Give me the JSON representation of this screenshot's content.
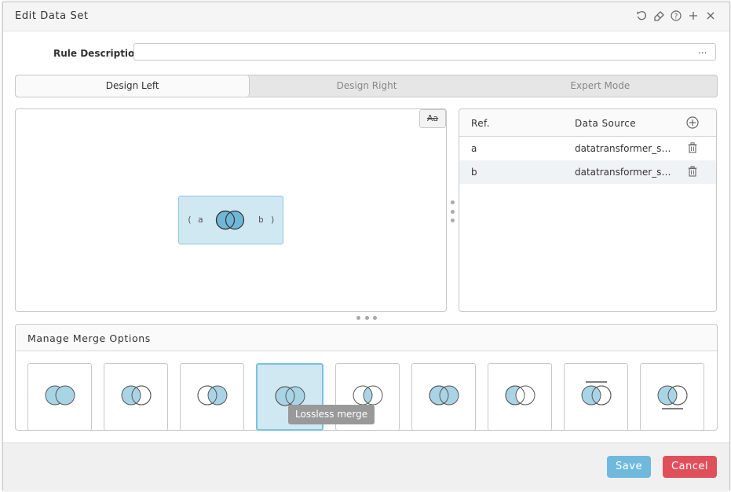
{
  "dialog": {
    "title": "Edit Data Set",
    "toolbar_icons": [
      "undo-icon",
      "eraser-icon",
      "help-icon",
      "plus-icon",
      "close-icon"
    ]
  },
  "rule": {
    "label": "Rule Description:",
    "value": "",
    "dots": "..."
  },
  "tabs": [
    {
      "label": "Design Left",
      "active": true
    },
    {
      "label": "Design Right",
      "active": false
    },
    {
      "label": "Expert Mode",
      "active": false
    }
  ],
  "canvas": {
    "aa_label": "Aa",
    "node": {
      "open": "(",
      "left": "a",
      "right": "b",
      "close": ")"
    }
  },
  "refs": {
    "header_ref": "Ref.",
    "header_source": "Data Source",
    "rows": [
      {
        "ref": "a",
        "source": "datatransformer_sample_a"
      },
      {
        "ref": "b",
        "source": "datatransformer_sample_b"
      }
    ]
  },
  "merge": {
    "title": "Manage Merge Options",
    "selected_index": 3,
    "tooltip": "Lossless merge",
    "options": [
      "full-outer-join-icon",
      "left-join-icon",
      "right-join-icon",
      "lossless-merge-icon",
      "inner-join-icon",
      "full-join-icon",
      "left-only-icon",
      "stack-top-icon",
      "stack-bottom-icon"
    ]
  },
  "footer": {
    "save": "Save",
    "cancel": "Cancel"
  },
  "colors": {
    "venn_fill": "#a9d4e6",
    "venn_stroke": "#555555",
    "selected_bg": "#cfe8f2",
    "save": "#6fbadc",
    "cancel": "#e0505b"
  }
}
